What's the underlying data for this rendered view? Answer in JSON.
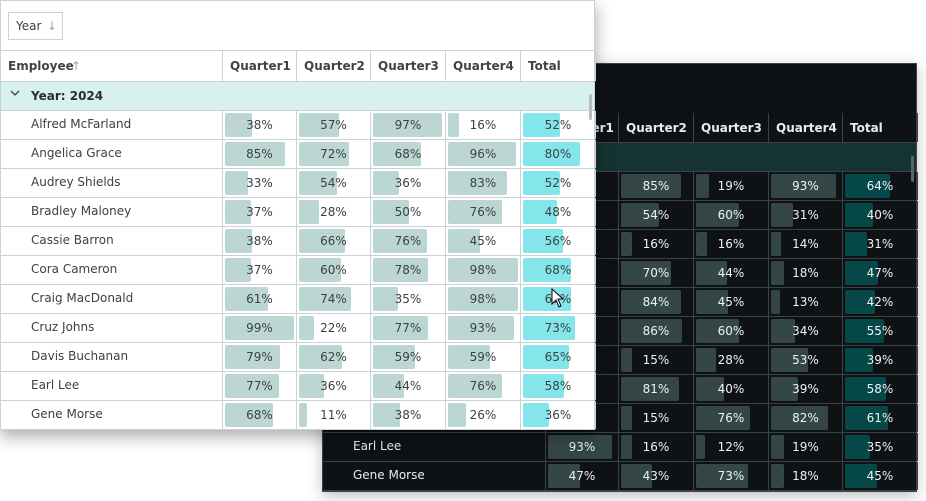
{
  "light_grid": {
    "group_chip": {
      "label": "Year",
      "icon": "arrow-down-icon",
      "arrow": "↓"
    },
    "columns": [
      {
        "label": "Employee",
        "sort_icon": "↑"
      },
      {
        "label": "Quarter1"
      },
      {
        "label": "Quarter2"
      },
      {
        "label": "Quarter3"
      },
      {
        "label": "Quarter4"
      },
      {
        "label": "Total"
      }
    ],
    "group": {
      "label": "Year: 2024",
      "expanded": true,
      "chevron": "⌵"
    },
    "rows": [
      {
        "name": "Alfred McFarland",
        "q1": 38,
        "q2": 57,
        "q3": 97,
        "q4": 16,
        "total": 52
      },
      {
        "name": "Angelica Grace",
        "q1": 85,
        "q2": 72,
        "q3": 68,
        "q4": 96,
        "total": 80
      },
      {
        "name": "Audrey Shields",
        "q1": 33,
        "q2": 54,
        "q3": 36,
        "q4": 83,
        "total": 52
      },
      {
        "name": "Bradley Maloney",
        "q1": 37,
        "q2": 28,
        "q3": 50,
        "q4": 76,
        "total": 48
      },
      {
        "name": "Cassie Barron",
        "q1": 38,
        "q2": 66,
        "q3": 76,
        "q4": 45,
        "total": 56
      },
      {
        "name": "Cora Cameron",
        "q1": 37,
        "q2": 60,
        "q3": 78,
        "q4": 98,
        "total": 68
      },
      {
        "name": "Craig MacDonald",
        "q1": 61,
        "q2": 74,
        "q3": 35,
        "q4": 98,
        "total": 67
      },
      {
        "name": "Cruz Johns",
        "q1": 99,
        "q2": 22,
        "q3": 77,
        "q4": 93,
        "total": 73
      },
      {
        "name": "Davis Buchanan",
        "q1": 79,
        "q2": 62,
        "q3": 59,
        "q4": 59,
        "total": 65
      },
      {
        "name": "Earl Lee",
        "q1": 77,
        "q2": 36,
        "q3": 44,
        "q4": 76,
        "total": 58
      },
      {
        "name": "Gene Morse",
        "q1": 68,
        "q2": 11,
        "q3": 38,
        "q4": 26,
        "total": 36
      }
    ]
  },
  "dark_grid": {
    "columns": [
      {
        "label": ""
      },
      {
        "label": "Quarter1"
      },
      {
        "label": "Quarter2"
      },
      {
        "label": "Quarter3"
      },
      {
        "label": "Quarter4"
      },
      {
        "label": "Total"
      }
    ],
    "rows": [
      {
        "name": "",
        "q1": null,
        "q2": 85,
        "q3": 19,
        "q4": 93,
        "total": 64
      },
      {
        "name": "",
        "q1": null,
        "q2": 54,
        "q3": 60,
        "q4": 31,
        "total": 40
      },
      {
        "name": "",
        "q1": null,
        "q2": 16,
        "q3": 16,
        "q4": 14,
        "total": 31
      },
      {
        "name": "",
        "q1": null,
        "q2": 70,
        "q3": 44,
        "q4": 18,
        "total": 47
      },
      {
        "name": "",
        "q1": null,
        "q2": 84,
        "q3": 45,
        "q4": 13,
        "total": 42
      },
      {
        "name": "",
        "q1": null,
        "q2": 86,
        "q3": 60,
        "q4": 34,
        "total": 55
      },
      {
        "name": "",
        "q1": null,
        "q2": 15,
        "q3": 28,
        "q4": 53,
        "total": 39
      },
      {
        "name": "",
        "q1": null,
        "q2": 81,
        "q3": 40,
        "q4": 39,
        "total": 58
      },
      {
        "name": "",
        "q1": null,
        "q2": 15,
        "q3": 76,
        "q4": 82,
        "total": 61
      },
      {
        "name": "Earl Lee",
        "q1": 93,
        "q2": 16,
        "q3": 12,
        "q4": 19,
        "total": 35
      },
      {
        "name": "Gene Morse",
        "q1": 47,
        "q2": 43,
        "q3": 73,
        "q4": 18,
        "total": 45
      }
    ]
  },
  "colors": {
    "light_bar": "#bcd6d3",
    "light_total_bar": "#84e6ea",
    "light_group_bg": "#d7f0f0",
    "dark_bg": "#0e1214",
    "dark_bar": "#344746",
    "dark_total_bar": "#064848",
    "dark_group_bg": "#143332"
  }
}
